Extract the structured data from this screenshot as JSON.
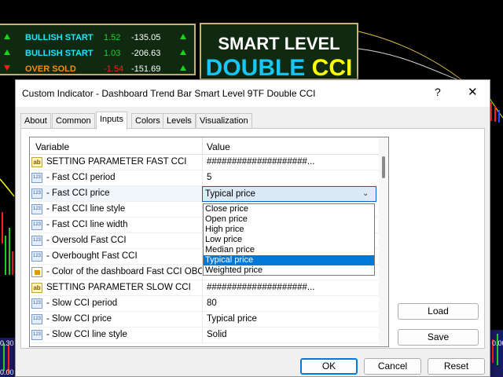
{
  "signals": [
    {
      "label": "BULLISH START",
      "v1": "1.52",
      "v2": "-135.05",
      "dir1": "up",
      "dir2": "up",
      "label_color": "#19e6ff",
      "v1_color": "#1fd11f"
    },
    {
      "label": "BULLISH START",
      "v1": "1.03",
      "v2": "-206.63",
      "dir1": "up",
      "dir2": "up",
      "label_color": "#19e6ff",
      "v1_color": "#1fd11f"
    },
    {
      "label": "OVER SOLD",
      "v1": "-1.54",
      "v2": "-151.69",
      "dir1": "down",
      "dir2": "up",
      "label_color": "#ff8c00",
      "v1_color": "#ff1a1a"
    }
  ],
  "title_panel": {
    "line1": "SMART LEVEL",
    "line2a": "DOUBLE",
    "line2b": "CCI"
  },
  "dialog": {
    "title": "Custom Indicator - Dashboard Trend Bar Smart Level 9TF Double CCI",
    "help": "?",
    "close": "✕",
    "tabs": [
      "About",
      "Common",
      "Inputs",
      "Colors",
      "Levels",
      "Visualization"
    ],
    "active_tab": "Inputs",
    "grid": {
      "col_variable": "Variable",
      "col_value": "Value",
      "rows": [
        {
          "icon": "ab",
          "name": "SETTING PARAMETER FAST CCI",
          "value": "####################..."
        },
        {
          "icon": "123",
          "name": "- Fast CCI period",
          "value": "5"
        },
        {
          "icon": "123",
          "name": "- Fast CCI price",
          "value": "Typical price",
          "selected": true
        },
        {
          "icon": "123",
          "name": "- Fast CCI line style",
          "value": ""
        },
        {
          "icon": "123",
          "name": "- Fast CCI line width",
          "value": ""
        },
        {
          "icon": "123",
          "name": "- Oversold Fast CCI",
          "value": ""
        },
        {
          "icon": "123",
          "name": "- Overbought Fast CCI",
          "value": ""
        },
        {
          "icon": "color",
          "name": "- Color of the dashboard Fast CCI OBO...",
          "value": ""
        },
        {
          "icon": "ab",
          "name": "SETTING PARAMETER SLOW CCI",
          "value": "####################..."
        },
        {
          "icon": "123",
          "name": "- Slow CCI period",
          "value": "80"
        },
        {
          "icon": "123",
          "name": "- Slow CCI price",
          "value": "Typical price"
        },
        {
          "icon": "123",
          "name": "- Slow CCI line style",
          "value": "Solid"
        }
      ]
    },
    "dropdown": {
      "options": [
        "Close price",
        "Open price",
        "High price",
        "Low price",
        "Median price",
        "Typical price",
        "Weighted price"
      ],
      "selected": "Typical price"
    },
    "buttons": {
      "load": "Load",
      "save": "Save",
      "ok": "OK",
      "cancel": "Cancel",
      "reset": "Reset"
    }
  },
  "background_chart": {
    "left_ticks": [
      "0.30",
      "0.00"
    ],
    "right_tick": "0.00",
    "colors": {
      "up_bar": "#1fd11f",
      "down_bar": "#ff2020",
      "line": "#ffff00"
    }
  }
}
